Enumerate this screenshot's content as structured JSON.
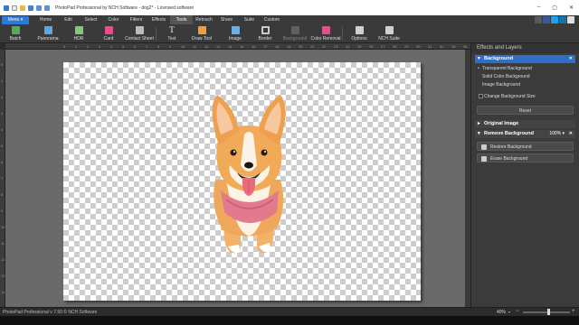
{
  "window": {
    "title": "PhotoPad Professional by NCH Software - dog2* - Licensed software",
    "controls": [
      "–",
      "▢",
      "✕"
    ]
  },
  "menubar": {
    "menu_label": "Menu ▾",
    "tabs": [
      "Home",
      "Edit",
      "Select",
      "Color",
      "Filters",
      "Effects",
      "Tools",
      "Retouch",
      "Share",
      "Suite",
      "Custom"
    ],
    "active_tab": "Tools"
  },
  "toolbar": {
    "tools": [
      {
        "label": "Batch",
        "icon": "batch-icon",
        "color": "#4caf50"
      },
      {
        "label": "Panorama",
        "icon": "panorama-icon",
        "color": "#5aa9e6"
      },
      {
        "label": "HDR",
        "icon": "hdr-icon",
        "color": "#7fc97f"
      },
      {
        "label": "Card",
        "icon": "card-icon",
        "color": "#e84c8b"
      },
      {
        "label": "Contact Sheet",
        "icon": "contact-sheet-icon",
        "color": "#bbbbbb"
      },
      {
        "label": "Text",
        "icon": "text-icon",
        "color": "#ffffff"
      },
      {
        "label": "Draw Tool",
        "icon": "draw-tool-icon",
        "color": "#f0a030"
      },
      {
        "label": "Image",
        "icon": "image-icon",
        "color": "#6ab0e0"
      },
      {
        "label": "Border",
        "icon": "border-icon",
        "color": "#cccccc"
      },
      {
        "label": "Background",
        "icon": "background-icon",
        "color": "#999999"
      },
      {
        "label": "Color Removal",
        "icon": "color-removal-icon",
        "color": "#e0508a"
      },
      {
        "label": "Options",
        "icon": "options-icon",
        "color": "#d0d0d0"
      },
      {
        "label": "NCH Suite",
        "icon": "nch-suite-icon",
        "color": "#d0d0d0"
      }
    ]
  },
  "rulers": {
    "top": [
      "0",
      "1",
      "2",
      "3",
      "4",
      "5",
      "6",
      "7",
      "8",
      "9",
      "10",
      "11",
      "12",
      "13",
      "14",
      "15",
      "16",
      "17",
      "18",
      "19",
      "20",
      "21",
      "22",
      "23",
      "24",
      "25",
      "26",
      "27",
      "28",
      "29",
      "30",
      "31",
      "32",
      "33",
      "34"
    ],
    "left": [
      "0",
      "1",
      "2",
      "3",
      "4",
      "5",
      "6",
      "7",
      "8",
      "9",
      "10",
      "11",
      "12",
      "13",
      "14"
    ]
  },
  "panel": {
    "title": "Effects and Layers",
    "background_section": {
      "title": "Background",
      "options": [
        "Transparent Background",
        "Solid Color Background",
        "Image Background"
      ],
      "selected": "Transparent Background",
      "checkbox_label": "Change Background Size",
      "reset_label": "Reset"
    },
    "original_image_section": {
      "title": "Original Image"
    },
    "remove_background_section": {
      "title": "Remove Background",
      "zoom": "100% ▾",
      "restore_label": "Restore Background",
      "erase_label": "Erase Background"
    }
  },
  "statusbar": {
    "text": "PhotoPad Professional v 7.50 © NCH Software",
    "zoom": "40%",
    "zoom_slider_fraction": 0.55
  }
}
